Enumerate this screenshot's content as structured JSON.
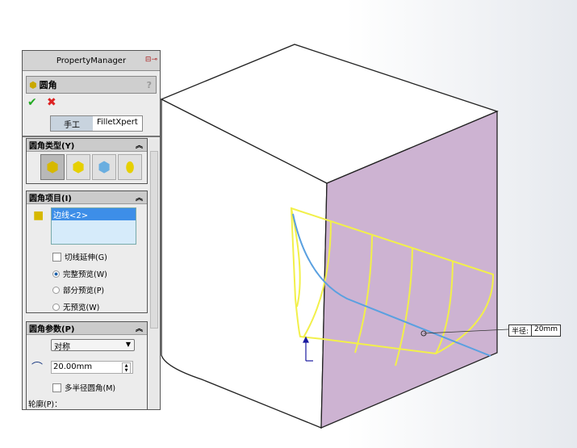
{
  "property_manager": {
    "title": "PropertyManager",
    "feature_name": "圆角",
    "help": "?",
    "ok_icon": "check-icon",
    "cancel_icon": "x-icon",
    "tabs": [
      "手工",
      "FilletXpert"
    ],
    "fillet_type": {
      "header": "圆角类型(Y)",
      "options": [
        "constant-size-fillet",
        "variable-size-fillet",
        "face-fillet",
        "full-round-fillet"
      ]
    },
    "fillet_items": {
      "header": "圆角项目(I)",
      "selected": "边线<2>",
      "tangent_propagation": "切线延伸(G)",
      "previews": [
        "完整预览(W)",
        "部分预览(P)",
        "无预览(W)"
      ],
      "selected_preview": 0
    },
    "fillet_params": {
      "header": "圆角参数(P)",
      "method": "对称",
      "radius": "20.00mm",
      "multi_radius": "多半径圆角(M)",
      "profile": "轮廓(P)："
    }
  },
  "viewport": {
    "callout_label": "半径:",
    "callout_value": "20mm",
    "face_color": "#cdb3d2",
    "preview_color": "#f2f04a",
    "edge_color": "#5aa0e0"
  }
}
